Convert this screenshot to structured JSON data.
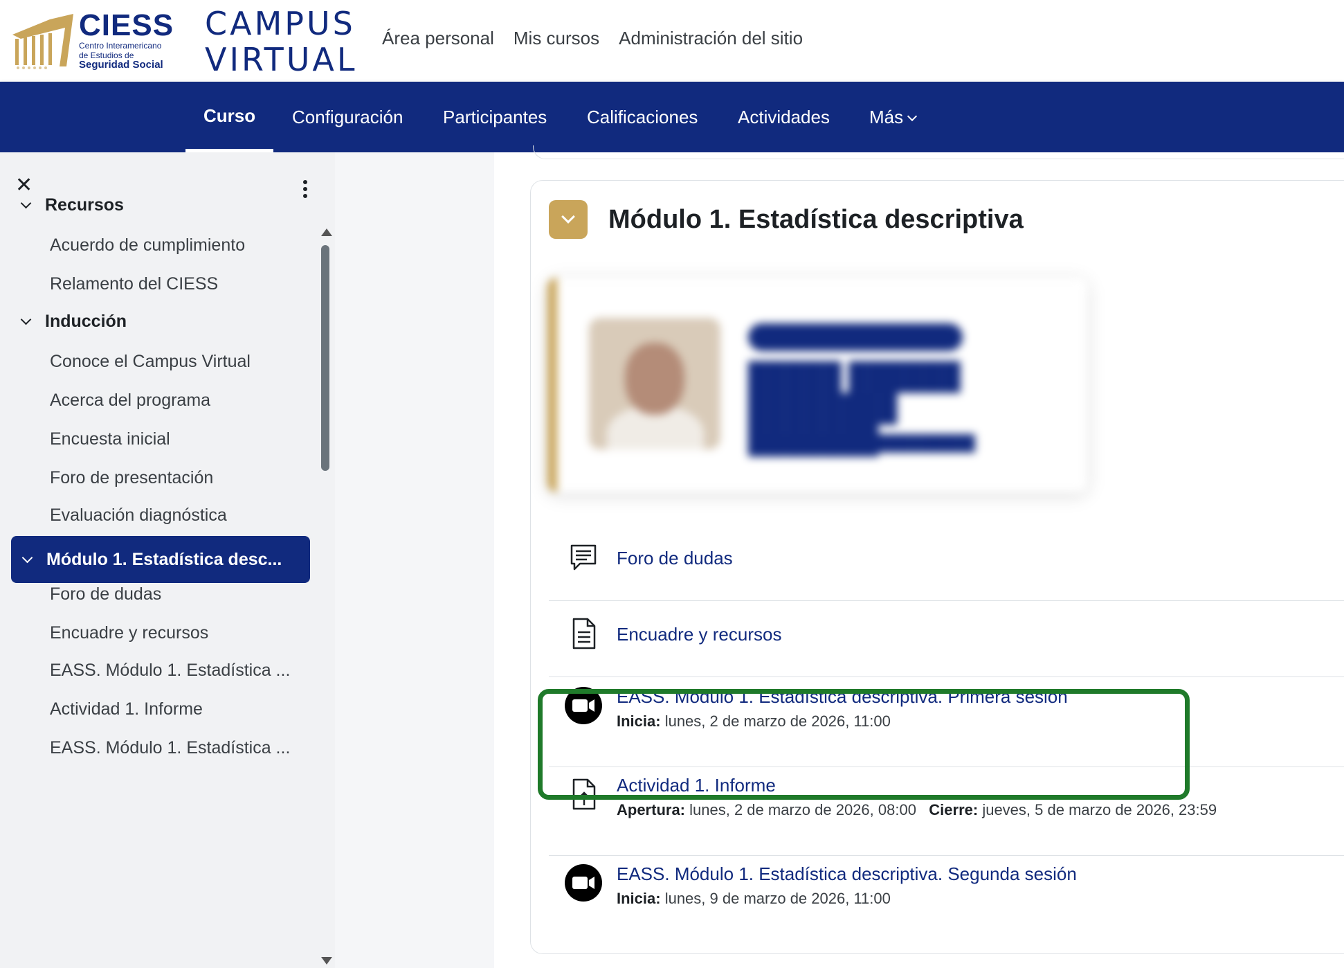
{
  "header": {
    "logo_name": "CIESS",
    "logo_sub1": "Centro Interamericano",
    "logo_sub2": "de Estudios de",
    "logo_sub3": "Seguridad Social",
    "campus_line1": "CAMPUS",
    "campus_line2": "VIRTUAL",
    "nav": [
      "Área personal",
      "Mis cursos",
      "Administración del sitio"
    ]
  },
  "course_nav": {
    "tabs": [
      "Curso",
      "Configuración",
      "Participantes",
      "Calificaciones",
      "Actividades",
      "Más"
    ],
    "active": "Curso"
  },
  "course_index": {
    "sections": [
      {
        "title": "Recursos",
        "items": [
          "Acuerdo de cumplimiento",
          "Relamento del CIESS"
        ]
      },
      {
        "title": "Inducción",
        "items": [
          "Conoce el Campus Virtual",
          "Acerca del programa",
          "Encuesta inicial",
          "Foro de presentación",
          "Evaluación diagnóstica"
        ]
      },
      {
        "title": "Módulo 1. Estadística desc...",
        "items": [
          "Foro de dudas",
          "Encuadre y recursos",
          "EASS. Módulo 1. Estadística ...",
          "Actividad 1. Informe",
          "EASS. Módulo 1. Estadística ..."
        ]
      }
    ]
  },
  "main": {
    "section_title": "Módulo 1. Estadística descriptiva",
    "activities": [
      {
        "title": "Foro de dudas",
        "icon": "forum-icon"
      },
      {
        "title": "Encuadre y recursos",
        "icon": "page-icon"
      },
      {
        "title": "EASS. Módulo 1. Estadística descriptiva. Primera sesión",
        "icon": "zoom-icon",
        "label1": "Inicia:",
        "value1": "lunes, 2 de marzo de 2026, 11:00"
      },
      {
        "title": "Actividad 1. Informe",
        "icon": "assignment-icon",
        "label1": "Apertura:",
        "value1": "lunes, 2 de marzo de 2026, 08:00",
        "label2": "Cierre:",
        "value2": "jueves, 5 de marzo de 2026, 23:59"
      },
      {
        "title": "EASS. Módulo 1. Estadística descriptiva. Segunda sesión",
        "icon": "zoom-icon",
        "label1": "Inicia:",
        "value1": "lunes, 9 de marzo de 2026, 11:00"
      }
    ]
  },
  "colors": {
    "brand_blue": "#112a7e",
    "accent_gold": "#c9a55a",
    "highlight_green": "#1f7a2a"
  }
}
